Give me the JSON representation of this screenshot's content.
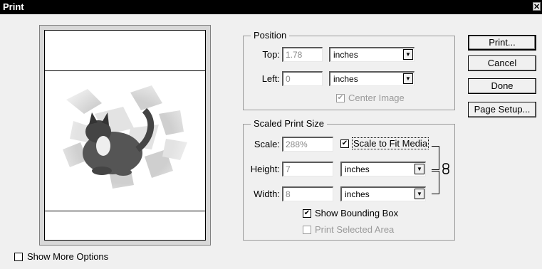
{
  "window": {
    "title": "Print",
    "close_glyph": "✕"
  },
  "position": {
    "legend": "Position",
    "top_label": "Top:",
    "top_value": "1.78",
    "top_unit": "inches",
    "left_label": "Left:",
    "left_value": "0",
    "left_unit": "inches",
    "center_image_label": "Center Image",
    "center_image_checked": true
  },
  "scaled": {
    "legend": "Scaled Print Size",
    "scale_label": "Scale:",
    "scale_value": "288%",
    "scale_to_fit_label": "Scale to Fit Media",
    "scale_to_fit_checked": true,
    "height_label": "Height:",
    "height_value": "7",
    "height_unit": "inches",
    "width_label": "Width:",
    "width_value": "8",
    "width_unit": "inches",
    "show_bounding_box_label": "Show Bounding Box",
    "show_bounding_box_checked": true,
    "print_selected_area_label": "Print Selected Area",
    "print_selected_area_checked": false
  },
  "buttons": {
    "print": "Print...",
    "cancel": "Cancel",
    "done": "Done",
    "page_setup": "Page Setup..."
  },
  "show_more_options": {
    "label": "Show More Options",
    "checked": false
  },
  "icons": {
    "check_glyph": "✔",
    "dropdown_glyph": "▼",
    "link": "chain-link-icon"
  }
}
